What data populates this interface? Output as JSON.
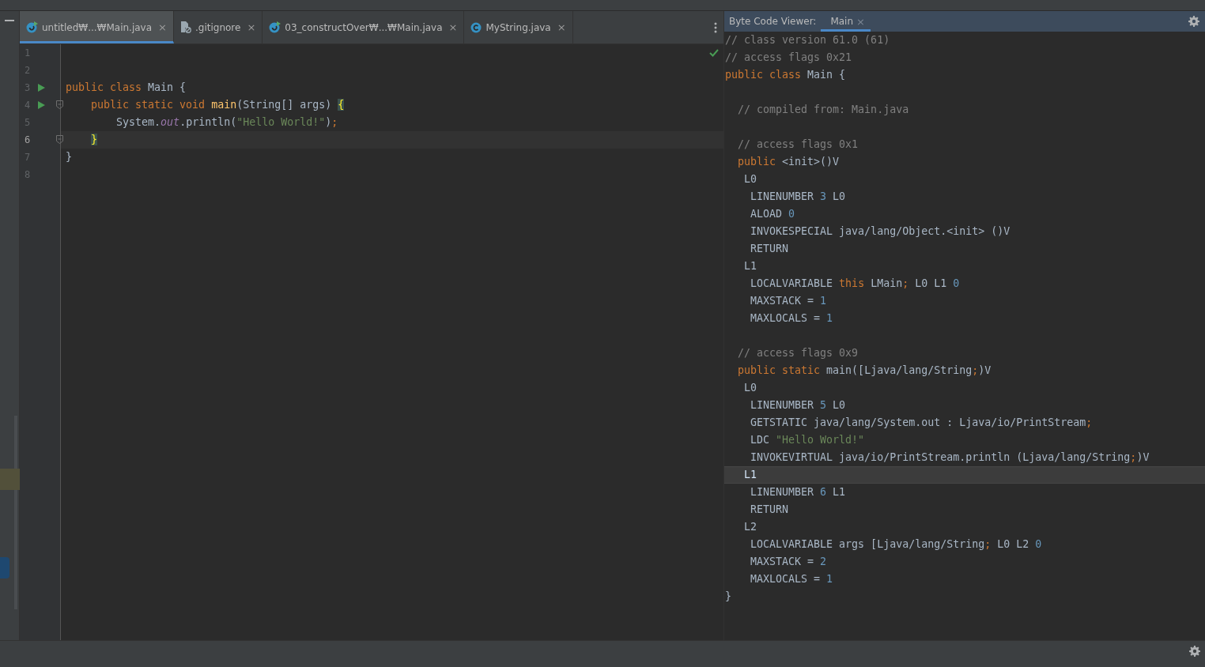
{
  "editor_tabs": [
    {
      "label": "untitled₩...₩Main.java",
      "kind": "class-run",
      "selected": true,
      "close": "×"
    },
    {
      "label": ".gitignore",
      "kind": "ignore",
      "selected": false,
      "close": "×"
    },
    {
      "label": "03_constructOver₩...₩Main.java",
      "kind": "class-run",
      "selected": false,
      "close": "×"
    },
    {
      "label": "MyString.java",
      "kind": "class",
      "selected": false,
      "close": "×"
    }
  ],
  "editor": {
    "lines": [
      {
        "number": "1",
        "run": false,
        "fold": false,
        "current": false
      },
      {
        "number": "2",
        "run": false,
        "fold": false,
        "current": false
      },
      {
        "number": "3",
        "run": true,
        "fold": false,
        "current": false,
        "tokens": [
          {
            "kind": "kw",
            "text": "public class "
          },
          {
            "kind": "plain",
            "text": "Main {"
          }
        ]
      },
      {
        "number": "4",
        "run": true,
        "fold": true,
        "current": false,
        "tokens": [
          {
            "kind": "kw",
            "text": "    public static void "
          },
          {
            "kind": "method",
            "text": "main"
          },
          {
            "kind": "plain",
            "text": "(String[] args) "
          },
          {
            "kind": "match",
            "text": "{"
          }
        ]
      },
      {
        "number": "5",
        "run": false,
        "fold": false,
        "current": false,
        "tokens": [
          {
            "kind": "plain",
            "text": "        System."
          },
          {
            "kind": "field",
            "text": "out"
          },
          {
            "kind": "plain",
            "text": ".println("
          },
          {
            "kind": "string",
            "text": "\"Hello World!\""
          },
          {
            "kind": "plain",
            "text": ")"
          },
          {
            "kind": "kw",
            "text": ";"
          }
        ]
      },
      {
        "number": "6",
        "run": false,
        "fold": true,
        "current": true,
        "tokens": [
          {
            "kind": "match",
            "text": "    }"
          }
        ]
      },
      {
        "number": "7",
        "run": false,
        "fold": false,
        "current": false,
        "tokens": [
          {
            "kind": "plain",
            "text": "}"
          }
        ]
      },
      {
        "number": "8",
        "run": false,
        "fold": false,
        "current": false
      }
    ]
  },
  "bytecode": {
    "label": "Byte Code Viewer:",
    "tabs": [
      {
        "label": "Main",
        "selected": true,
        "close": "×"
      }
    ],
    "lines": [
      {
        "current": false,
        "tokens": [
          {
            "kind": "comment",
            "text": "// class version 61.0 (61)"
          }
        ]
      },
      {
        "current": false,
        "tokens": [
          {
            "kind": "comment",
            "text": "// access flags 0x21"
          }
        ]
      },
      {
        "current": false,
        "tokens": [
          {
            "kind": "kw",
            "text": "public class "
          },
          {
            "kind": "plain",
            "text": "Main {"
          }
        ]
      },
      {
        "current": false
      },
      {
        "current": false,
        "tokens": [
          {
            "kind": "comment",
            "text": "  // compiled from: Main.java"
          }
        ]
      },
      {
        "current": false
      },
      {
        "current": false,
        "tokens": [
          {
            "kind": "comment",
            "text": "  // access flags 0x1"
          }
        ]
      },
      {
        "current": false,
        "tokens": [
          {
            "kind": "kw",
            "text": "  public "
          },
          {
            "kind": "plain",
            "text": "<init>()V"
          }
        ]
      },
      {
        "current": false,
        "tokens": [
          {
            "kind": "plain",
            "text": "   L0"
          }
        ]
      },
      {
        "current": false,
        "tokens": [
          {
            "kind": "plain",
            "text": "    LINENUMBER "
          },
          {
            "kind": "num",
            "text": "3"
          },
          {
            "kind": "plain",
            "text": " L0"
          }
        ]
      },
      {
        "current": false,
        "tokens": [
          {
            "kind": "plain",
            "text": "    ALOAD "
          },
          {
            "kind": "num",
            "text": "0"
          }
        ]
      },
      {
        "current": false,
        "tokens": [
          {
            "kind": "plain",
            "text": "    INVOKESPECIAL java/lang/Object.<init> ()V"
          }
        ]
      },
      {
        "current": false,
        "tokens": [
          {
            "kind": "plain",
            "text": "    RETURN"
          }
        ]
      },
      {
        "current": false,
        "tokens": [
          {
            "kind": "plain",
            "text": "   L1"
          }
        ]
      },
      {
        "current": false,
        "tokens": [
          {
            "kind": "plain",
            "text": "    LOCALVARIABLE "
          },
          {
            "kind": "kw",
            "text": "this "
          },
          {
            "kind": "plain",
            "text": "LMain"
          },
          {
            "kind": "kw",
            "text": ";"
          },
          {
            "kind": "plain",
            "text": " L0 L1 "
          },
          {
            "kind": "num",
            "text": "0"
          }
        ]
      },
      {
        "current": false,
        "tokens": [
          {
            "kind": "plain",
            "text": "    MAXSTACK = "
          },
          {
            "kind": "num",
            "text": "1"
          }
        ]
      },
      {
        "current": false,
        "tokens": [
          {
            "kind": "plain",
            "text": "    MAXLOCALS = "
          },
          {
            "kind": "num",
            "text": "1"
          }
        ]
      },
      {
        "current": false
      },
      {
        "current": false,
        "tokens": [
          {
            "kind": "comment",
            "text": "  // access flags 0x9"
          }
        ]
      },
      {
        "current": false,
        "tokens": [
          {
            "kind": "kw",
            "text": "  public static "
          },
          {
            "kind": "plain",
            "text": "main([Ljava/lang/String"
          },
          {
            "kind": "kw",
            "text": ";"
          },
          {
            "kind": "plain",
            "text": ")V"
          }
        ]
      },
      {
        "current": false,
        "tokens": [
          {
            "kind": "plain",
            "text": "   L0"
          }
        ]
      },
      {
        "current": false,
        "tokens": [
          {
            "kind": "plain",
            "text": "    LINENUMBER "
          },
          {
            "kind": "num",
            "text": "5"
          },
          {
            "kind": "plain",
            "text": " L0"
          }
        ]
      },
      {
        "current": false,
        "tokens": [
          {
            "kind": "plain",
            "text": "    GETSTATIC java/lang/System.out : Ljava/io/PrintStream"
          },
          {
            "kind": "kw",
            "text": ";"
          }
        ]
      },
      {
        "current": false,
        "tokens": [
          {
            "kind": "plain",
            "text": "    LDC "
          },
          {
            "kind": "string",
            "text": "\"Hello World!\""
          }
        ]
      },
      {
        "current": false,
        "tokens": [
          {
            "kind": "plain",
            "text": "    INVOKEVIRTUAL java/io/PrintStream.println (Ljava/lang/String"
          },
          {
            "kind": "kw",
            "text": ";"
          },
          {
            "kind": "plain",
            "text": ")V"
          }
        ]
      },
      {
        "current": true,
        "tokens": [
          {
            "kind": "plain",
            "text": "   L1"
          }
        ]
      },
      {
        "current": false,
        "tokens": [
          {
            "kind": "plain",
            "text": "    LINENUMBER "
          },
          {
            "kind": "num",
            "text": "6"
          },
          {
            "kind": "plain",
            "text": " L1"
          }
        ]
      },
      {
        "current": false,
        "tokens": [
          {
            "kind": "plain",
            "text": "    RETURN"
          }
        ]
      },
      {
        "current": false,
        "tokens": [
          {
            "kind": "plain",
            "text": "   L2"
          }
        ]
      },
      {
        "current": false,
        "tokens": [
          {
            "kind": "plain",
            "text": "    LOCALVARIABLE args [Ljava/lang/String"
          },
          {
            "kind": "kw",
            "text": ";"
          },
          {
            "kind": "plain",
            "text": " L0 L2 "
          },
          {
            "kind": "num",
            "text": "0"
          }
        ]
      },
      {
        "current": false,
        "tokens": [
          {
            "kind": "plain",
            "text": "    MAXSTACK = "
          },
          {
            "kind": "num",
            "text": "2"
          }
        ]
      },
      {
        "current": false,
        "tokens": [
          {
            "kind": "plain",
            "text": "    MAXLOCALS = "
          },
          {
            "kind": "num",
            "text": "1"
          }
        ]
      },
      {
        "current": false,
        "tokens": [
          {
            "kind": "plain",
            "text": "}"
          }
        ]
      }
    ]
  }
}
